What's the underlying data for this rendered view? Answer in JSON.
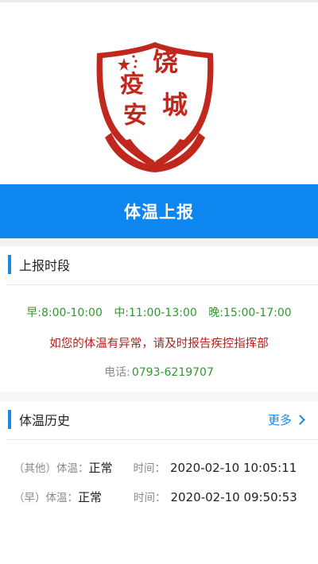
{
  "emblem": {
    "chars": [
      "饶",
      "城",
      "疫",
      "安"
    ],
    "colors": {
      "red": "#c0281e",
      "white": "#ffffff"
    }
  },
  "banner": {
    "title": "体温上报",
    "color": "#0e86f0"
  },
  "report_period": {
    "heading": "上报时段",
    "periods": [
      "早:8:00-10:00",
      "中:11:00-13:00",
      "晚:15:00-17:00"
    ],
    "notice": "如您的体温有异常，请及时报告疾控指挥部",
    "phone_label": "电话:",
    "phone_number": "0793-6219707"
  },
  "history": {
    "heading": "体温历史",
    "more_label": "更多",
    "records": [
      {
        "kind": "（其他）",
        "temp_label": "体温：",
        "status": "正常",
        "time_label": "时间：",
        "time": "2020-02-10 10:05:11"
      },
      {
        "kind": "（早）",
        "temp_label": "体温：",
        "status": "正常",
        "time_label": "时间：",
        "time": "2020-02-10 09:50:53"
      }
    ]
  },
  "colors": {
    "accent_blue": "#1e88e5",
    "period_green": "#2e9a2e",
    "warning_red": "#b1211d"
  }
}
